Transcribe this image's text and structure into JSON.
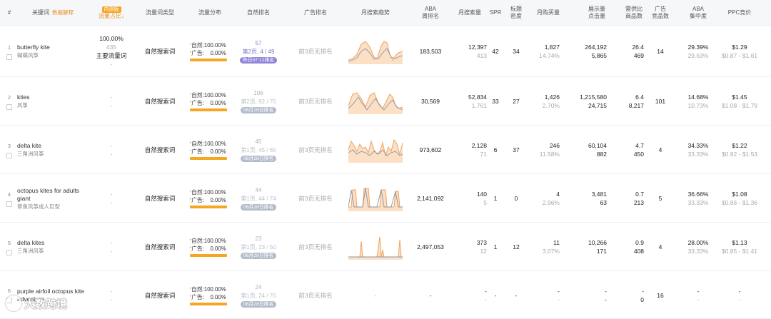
{
  "header": {
    "index": "#",
    "keyword": "关键词",
    "keyword_link": "数据解释",
    "share_badge": "内测版",
    "share": "流量占比",
    "share_arrow": "↓",
    "type": "流量词类型",
    "dist": "流量分布",
    "organic_rank": "自然排名",
    "ad_rank": "广告排名",
    "trend": "月搜索趋势",
    "aba_top": "ABA",
    "aba_bottom": "周排名",
    "monthly_search": "月搜索量",
    "spr": "SPR",
    "title_top": "标题",
    "title_bottom": "密度",
    "monthly_purchase": "月购买量",
    "impr_top": "展示量",
    "impr_bottom": "点击量",
    "supply_top": "需供比",
    "supply_bottom": "商品数",
    "ad_top": "广告",
    "ad_bottom": "竞品数",
    "conc_top": "ABA",
    "conc_bottom": "集中度",
    "ppc": "PPC竞价"
  },
  "rows": [
    {
      "index": "1",
      "kw_en": "butterfly kite",
      "kw_cn": "蝴蝶风筝",
      "share_pct": "100.00%",
      "share_num": "435",
      "share_tag": "主要流量词",
      "share_sub": "-",
      "type": "自然搜索词",
      "organic_label": "自然:",
      "organic_pct": "100.00%",
      "ad_label": "广告:",
      "ad_pct": "0.00%",
      "rank_num": "57",
      "rank_pos": "第2页, 4 / 49",
      "rank_badge": "昨日07:12排名",
      "ad_rank": "前3页无排名",
      "trend": [
        [
          0,
          30
        ],
        [
          6,
          28
        ],
        [
          12,
          22
        ],
        [
          18,
          8
        ],
        [
          24,
          4
        ],
        [
          30,
          12
        ],
        [
          36,
          26
        ],
        [
          40,
          28
        ],
        [
          46,
          10
        ],
        [
          50,
          4
        ],
        [
          54,
          6
        ],
        [
          58,
          22
        ],
        [
          62,
          30
        ],
        [
          66,
          24
        ],
        [
          70,
          20
        ],
        [
          76,
          18
        ]
      ],
      "trend2": [
        [
          0,
          32
        ],
        [
          6,
          30
        ],
        [
          12,
          27
        ],
        [
          18,
          18
        ],
        [
          24,
          14
        ],
        [
          30,
          20
        ],
        [
          36,
          29
        ],
        [
          42,
          28
        ],
        [
          48,
          20
        ],
        [
          54,
          14
        ],
        [
          60,
          26
        ],
        [
          66,
          28
        ],
        [
          72,
          25
        ],
        [
          76,
          24
        ]
      ],
      "aba": "183,503",
      "ms_top": "12,397",
      "ms_bottom": "413",
      "spr": "42",
      "title_density": "34",
      "mp_top": "1,827",
      "mp_bottom": "14.74%",
      "imp_top": "264,192",
      "imp_bottom": "5,865",
      "sd_top": "26.4",
      "sd_bottom": "469",
      "ad_count": "14",
      "conc_top": "29.39%",
      "conc_bottom": "29.63%",
      "ppc_top": "$1.29",
      "ppc_bottom": "$0.87 - $1.61"
    },
    {
      "index": "2",
      "kw_en": "kites",
      "kw_cn": "风筝",
      "share_pct": "",
      "share_num": "-",
      "share_tag": "",
      "share_sub": "-",
      "type": "自然搜索词",
      "organic_label": "自然:",
      "organic_pct": "100.00%",
      "ad_label": "广告:",
      "ad_pct": "0.00%",
      "rank_num": "106",
      "rank_pos": "第2页, 92 / 70",
      "rank_badge": "06月28日排名",
      "ad_rank": "前3页无排名",
      "trend": [
        [
          0,
          24
        ],
        [
          6,
          8
        ],
        [
          12,
          6
        ],
        [
          18,
          14
        ],
        [
          24,
          26
        ],
        [
          30,
          10
        ],
        [
          36,
          6
        ],
        [
          42,
          20
        ],
        [
          48,
          28
        ],
        [
          54,
          16
        ],
        [
          58,
          8
        ],
        [
          62,
          12
        ],
        [
          66,
          24
        ],
        [
          70,
          28
        ],
        [
          76,
          26
        ]
      ],
      "trend2": [
        [
          0,
          28
        ],
        [
          8,
          20
        ],
        [
          14,
          12
        ],
        [
          20,
          22
        ],
        [
          26,
          30
        ],
        [
          32,
          22
        ],
        [
          38,
          14
        ],
        [
          44,
          24
        ],
        [
          50,
          30
        ],
        [
          56,
          22
        ],
        [
          62,
          16
        ],
        [
          68,
          26
        ],
        [
          76,
          30
        ]
      ],
      "aba": "30,569",
      "ms_top": "52,834",
      "ms_bottom": "1,761",
      "spr": "33",
      "title_density": "27",
      "mp_top": "1,426",
      "mp_bottom": "2.70%",
      "imp_top": "1,215,580",
      "imp_bottom": "24,715",
      "sd_top": "6.4",
      "sd_bottom": "8,217",
      "ad_count": "101",
      "conc_top": "14.68%",
      "conc_bottom": "10.73%",
      "ppc_top": "$1.45",
      "ppc_bottom": "$1.08 - $1.79"
    },
    {
      "index": "3",
      "kw_en": "delta kite",
      "kw_cn": "三角洲风筝",
      "share_pct": "",
      "share_num": "-",
      "share_tag": "",
      "share_sub": "-",
      "type": "自然搜索词",
      "organic_label": "自然:",
      "organic_pct": "100.00%",
      "ad_label": "广告:",
      "ad_pct": "0.00%",
      "rank_num": "45",
      "rank_pos": "第1页, 45 / 65",
      "rank_badge": "06月28日排名",
      "ad_rank": "前3页无排名",
      "trend": [
        [
          0,
          18
        ],
        [
          4,
          6
        ],
        [
          8,
          12
        ],
        [
          12,
          20
        ],
        [
          16,
          10
        ],
        [
          20,
          16
        ],
        [
          24,
          14
        ],
        [
          28,
          22
        ],
        [
          32,
          6
        ],
        [
          36,
          18
        ],
        [
          40,
          24
        ],
        [
          44,
          20
        ],
        [
          48,
          8
        ],
        [
          52,
          26
        ],
        [
          56,
          14
        ],
        [
          60,
          20
        ],
        [
          64,
          4
        ],
        [
          68,
          10
        ],
        [
          72,
          24
        ],
        [
          76,
          8
        ]
      ],
      "trend2": [
        [
          0,
          22
        ],
        [
          6,
          18
        ],
        [
          12,
          24
        ],
        [
          18,
          20
        ],
        [
          24,
          22
        ],
        [
          30,
          26
        ],
        [
          36,
          20
        ],
        [
          42,
          24
        ],
        [
          48,
          18
        ],
        [
          54,
          26
        ],
        [
          60,
          22
        ],
        [
          66,
          20
        ],
        [
          72,
          26
        ],
        [
          76,
          24
        ]
      ],
      "aba": "973,602",
      "ms_top": "2,128",
      "ms_bottom": "71",
      "spr": "6",
      "title_density": "37",
      "mp_top": "246",
      "mp_bottom": "11.58%",
      "imp_top": "60,104",
      "imp_bottom": "882",
      "sd_top": "4.7",
      "sd_bottom": "450",
      "ad_count": "4",
      "conc_top": "34.33%",
      "conc_bottom": "33.33%",
      "ppc_top": "$1.22",
      "ppc_bottom": "$0.92 - $1.53"
    },
    {
      "index": "4",
      "kw_en": "octopus kites for adults giant",
      "kw_cn": "章鱼风筝成人巨型",
      "share_pct": "",
      "share_num": "-",
      "share_tag": "",
      "share_sub": "-",
      "type": "自然搜索词",
      "organic_label": "自然:",
      "organic_pct": "100.00%",
      "ad_label": "广告:",
      "ad_pct": "0.00%",
      "rank_num": "44",
      "rank_pos": "第1页, 44 / 74",
      "rank_badge": "06月28日排名",
      "ad_rank": "前3页无排名",
      "trend": [
        [
          0,
          30
        ],
        [
          4,
          30
        ],
        [
          6,
          6
        ],
        [
          10,
          6
        ],
        [
          12,
          30
        ],
        [
          20,
          30
        ],
        [
          22,
          4
        ],
        [
          28,
          4
        ],
        [
          30,
          30
        ],
        [
          44,
          30
        ],
        [
          46,
          6
        ],
        [
          52,
          6
        ],
        [
          54,
          30
        ],
        [
          64,
          30
        ],
        [
          66,
          8
        ],
        [
          70,
          8
        ],
        [
          72,
          30
        ],
        [
          76,
          30
        ]
      ],
      "trend2": [
        [
          0,
          30
        ],
        [
          4,
          6
        ],
        [
          8,
          30
        ],
        [
          20,
          30
        ],
        [
          24,
          4
        ],
        [
          28,
          30
        ],
        [
          40,
          30
        ],
        [
          46,
          6
        ],
        [
          50,
          30
        ],
        [
          60,
          30
        ],
        [
          66,
          8
        ],
        [
          70,
          30
        ],
        [
          76,
          30
        ]
      ],
      "aba": "2,141,092",
      "ms_top": "140",
      "ms_bottom": "5",
      "spr": "1",
      "title_density": "0",
      "mp_top": "4",
      "mp_bottom": "2.96%",
      "imp_top": "3,481",
      "imp_bottom": "63",
      "sd_top": "0.7",
      "sd_bottom": "213",
      "ad_count": "5",
      "conc_top": "36.66%",
      "conc_bottom": "33.33%",
      "ppc_top": "$1.08",
      "ppc_bottom": "$0.86 - $1.36"
    },
    {
      "index": "5",
      "kw_en": "delta kites",
      "kw_cn": "三角洲风筝",
      "share_pct": "",
      "share_num": "-",
      "share_tag": "",
      "share_sub": "-",
      "type": "自然搜索词",
      "organic_label": "自然:",
      "organic_pct": "100.00%",
      "ad_label": "广告:",
      "ad_pct": "0.00%",
      "rank_num": "23",
      "rank_pos": "第1页, 23 / 50",
      "rank_badge": "06月28日排名",
      "ad_rank": "前3页无排名",
      "trend": [
        [
          0,
          32
        ],
        [
          16,
          32
        ],
        [
          18,
          10
        ],
        [
          20,
          32
        ],
        [
          40,
          32
        ],
        [
          44,
          4
        ],
        [
          46,
          32
        ],
        [
          48,
          22
        ],
        [
          50,
          32
        ],
        [
          70,
          32
        ],
        [
          72,
          8
        ],
        [
          74,
          32
        ],
        [
          76,
          32
        ]
      ],
      "trend2": [
        [
          0,
          32
        ],
        [
          76,
          32
        ]
      ],
      "aba": "2,497,053",
      "ms_top": "373",
      "ms_bottom": "12",
      "spr": "1",
      "title_density": "12",
      "mp_top": "11",
      "mp_bottom": "3.07%",
      "imp_top": "10,266",
      "imp_bottom": "171",
      "sd_top": "0.9",
      "sd_bottom": "408",
      "ad_count": "4",
      "conc_top": "28.00%",
      "conc_bottom": "33.33%",
      "ppc_top": "$1.13",
      "ppc_bottom": "$0.85 - $1.41"
    },
    {
      "index": "6",
      "kw_en": "purple airfoil octopus kite adventure",
      "kw_cn": "",
      "share_pct": "",
      "share_num": "-",
      "share_tag": "",
      "share_sub": "-",
      "type": "自然搜索词",
      "organic_label": "自然:",
      "organic_pct": "100.00%",
      "ad_label": "广告:",
      "ad_pct": "0.00%",
      "rank_num": "24",
      "rank_pos": "第1页, 24 / 70",
      "rank_badge": "06月28日排名",
      "ad_rank": "前3页无排名",
      "trend": [],
      "trend2": [],
      "trend_empty": "-",
      "aba": "-",
      "ms_top": "-",
      "ms_bottom": "-",
      "spr": "-",
      "title_density": "-",
      "mp_top": "-",
      "mp_bottom": "-",
      "imp_top": "-",
      "imp_bottom": "-",
      "sd_top": "-",
      "sd_bottom": "0",
      "ad_count": "16",
      "conc_top": "-",
      "conc_bottom": "-",
      "ppc_top": "-",
      "ppc_bottom": "-"
    }
  ],
  "watermark": "大数跨境",
  "colors": {
    "accent": "#f5a623",
    "trend_fill": "#fbe0c6",
    "trend_line": "#f0a35e",
    "trend_line2": "#8e94a6",
    "purple": "#8f86d8"
  }
}
